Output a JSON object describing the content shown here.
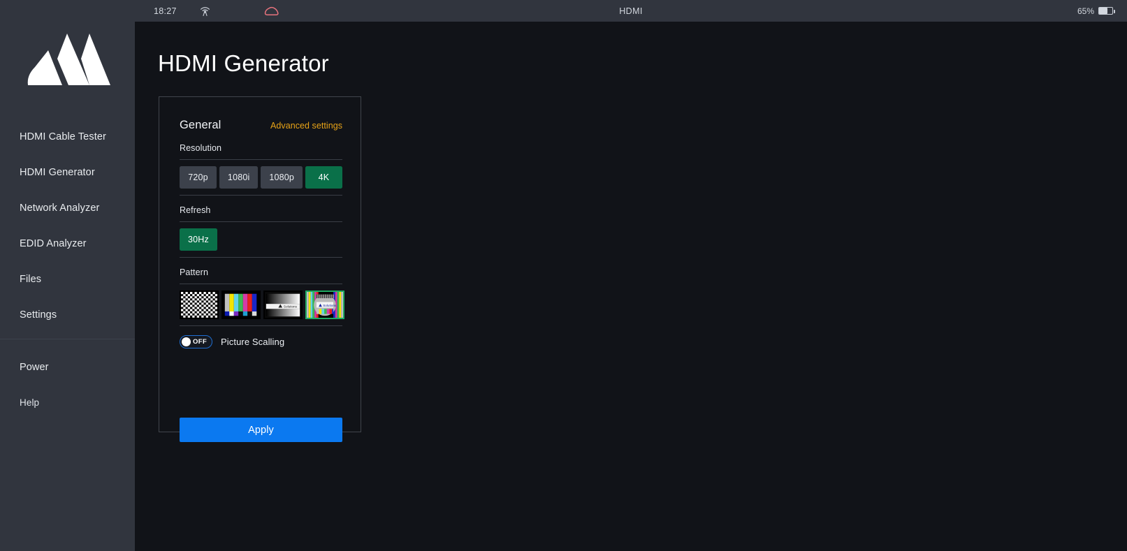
{
  "statusbar": {
    "time": "18:27",
    "wifi_icon": "wifi-signal-icon",
    "cloud_icon": "cloud-icon",
    "cloud_color": "#e8737d",
    "center_label": "HDMI",
    "battery_percent": "65%",
    "battery_level": 65
  },
  "sidebar": {
    "logo_icon": "mountain-logo",
    "items": [
      {
        "label": "HDMI Cable Tester",
        "name": "hdmi-cable-tester"
      },
      {
        "label": "HDMI Generator",
        "name": "hdmi-generator"
      },
      {
        "label": "Network Analyzer",
        "name": "network-analyzer"
      },
      {
        "label": "EDID Analyzer",
        "name": "edid-analyzer"
      },
      {
        "label": "Files",
        "name": "files"
      },
      {
        "label": "Settings",
        "name": "settings"
      }
    ],
    "footer_items": [
      {
        "label": "Power",
        "name": "power"
      },
      {
        "label": "Help",
        "name": "help"
      }
    ]
  },
  "page": {
    "title": "HDMI Generator"
  },
  "card": {
    "title": "General",
    "advanced_link": "Advanced settings",
    "advanced_link_color": "#e8a317",
    "resolution": {
      "label": "Resolution",
      "options": [
        "720p",
        "1080i",
        "1080p",
        "4K"
      ],
      "selected": "4K"
    },
    "refresh": {
      "label": "Refresh",
      "options": [
        "30Hz"
      ],
      "selected": "30Hz"
    },
    "pattern": {
      "label": "Pattern",
      "options": [
        {
          "name": "checkerboard-pattern"
        },
        {
          "name": "color-bars-pattern"
        },
        {
          "name": "grayscale-ramp-pattern"
        },
        {
          "name": "test-circle-pattern"
        }
      ],
      "selected_index": 3,
      "selected_border_color": "#1faa62"
    },
    "picture_scaling": {
      "label": "Picture Scalling",
      "state": "OFF",
      "on": false
    },
    "apply_label": "Apply",
    "apply_color": "#0b79f0",
    "selected_color": "#0a7049"
  }
}
